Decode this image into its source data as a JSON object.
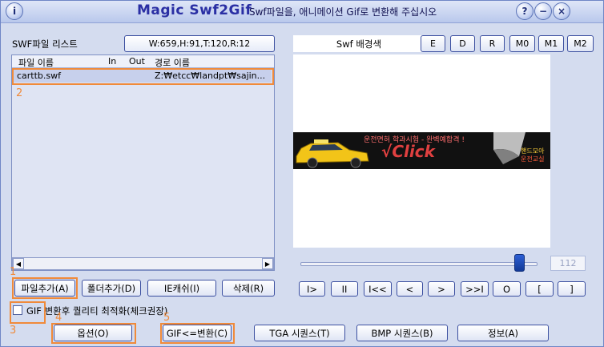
{
  "titlebar": {
    "app_name": "Magic  Swf2Gif",
    "subtitle": "Swf파일을, 애니메이션 Gif로 변환해 주십시오",
    "info_btn": "i",
    "help_btn": "?",
    "minimize_btn": "−",
    "close_btn": "×"
  },
  "file_panel": {
    "list_label": "SWF파일 리스트",
    "info": "W:659,H:91,T:120,R:12",
    "columns": [
      "파일 이름",
      "In",
      "Out",
      "경로 이름"
    ],
    "rows": [
      {
        "name": "carttb.swf",
        "in": "",
        "out": "",
        "path": "Z:₩etcc₩landpt₩sajin..."
      }
    ]
  },
  "preview": {
    "bg_color_label": "Swf 배경색",
    "buttons": [
      "E",
      "D",
      "R",
      "M0",
      "M1",
      "M2"
    ],
    "banner_top": "운전면허 학과시험 - 완벽예합격 !",
    "banner_main": "√Click",
    "banner_right_1": "핸드모아",
    "banner_right_2": "운전교실",
    "frame_value": "112"
  },
  "file_buttons": [
    "파일추가(A)",
    "폴더추가(D)",
    "IE캐쉬(I)",
    "삭제(R)"
  ],
  "playback_buttons": [
    "I>",
    "II",
    "I<<",
    "<",
    ">",
    ">>I",
    "O",
    "[",
    "]"
  ],
  "gif_option": {
    "label": "GIF 변환후 퀄리티 최적화(체크권장)",
    "checked": false
  },
  "bottom_buttons": [
    "옵션(O)",
    "GIF<=변환(C)",
    "TGA 시퀀스(T)",
    "BMP 시퀀스(B)",
    "정보(A)"
  ],
  "annotations": [
    "1",
    "2",
    "3",
    "4",
    "5"
  ],
  "colors": {
    "window_bg": "#d4dcef",
    "accent": "#2a2fa4",
    "annotation": "#f08a3a"
  }
}
